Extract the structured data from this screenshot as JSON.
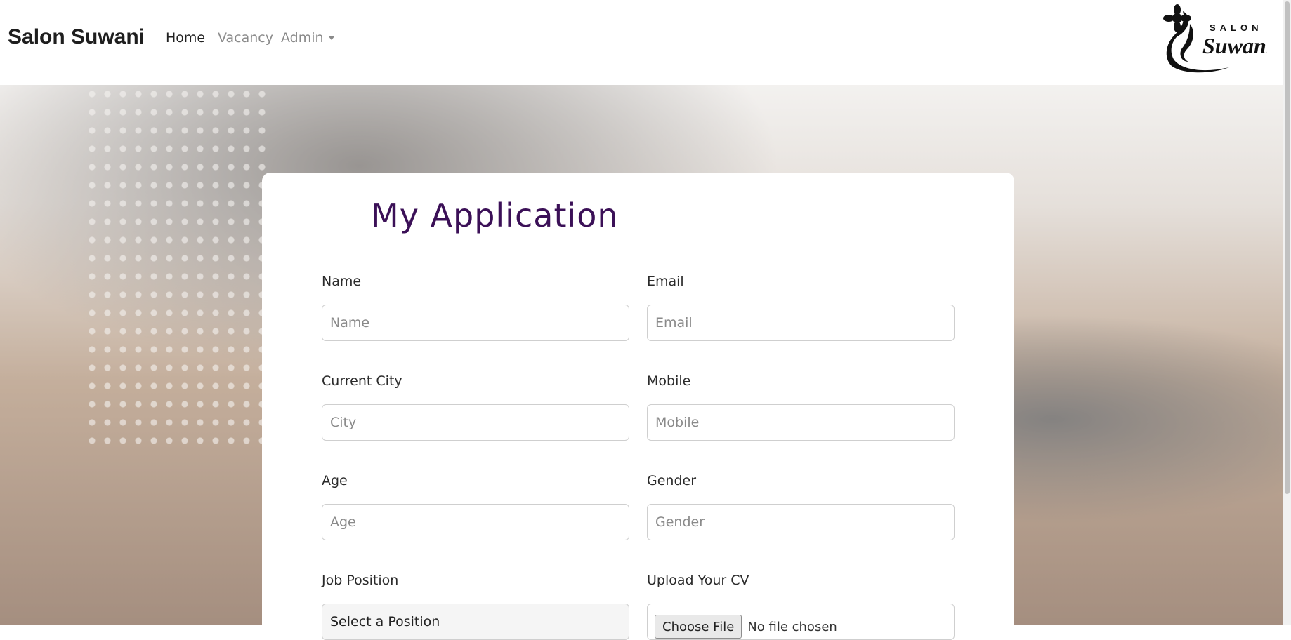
{
  "nav": {
    "brand": "Salon Suwani",
    "links": [
      {
        "label": "Home",
        "active": true
      },
      {
        "label": "Vacancy",
        "active": false
      },
      {
        "label": "Admin",
        "active": false
      }
    ],
    "logo": {
      "small_text": "SALON",
      "big_text": "Suwani"
    }
  },
  "form": {
    "title": "My Application",
    "name": {
      "label": "Name",
      "placeholder": "Name"
    },
    "email": {
      "label": "Email",
      "placeholder": "Email"
    },
    "city": {
      "label": "Current City",
      "placeholder": "City"
    },
    "mobile": {
      "label": "Mobile",
      "placeholder": "Mobile"
    },
    "age": {
      "label": "Age",
      "placeholder": "Age"
    },
    "gender": {
      "label": "Gender",
      "placeholder": "Gender"
    },
    "position": {
      "label": "Job Position",
      "selected": "Select a Position"
    },
    "cv": {
      "label": "Upload Your CV",
      "button": "Choose File",
      "status": "No file chosen"
    }
  },
  "colors": {
    "title": "#3b1057",
    "brand": "#1e1e1e"
  }
}
